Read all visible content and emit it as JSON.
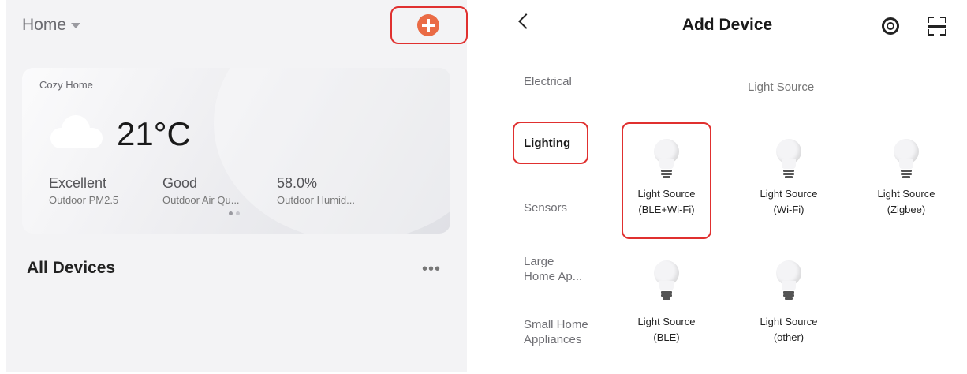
{
  "left": {
    "home_title": "Home",
    "card": {
      "label": "Cozy Home",
      "temperature": "21°C",
      "metrics": [
        {
          "value": "Excellent",
          "label": "Outdoor PM2.5"
        },
        {
          "value": "Good",
          "label": "Outdoor Air Qu..."
        },
        {
          "value": "58.0%",
          "label": "Outdoor Humid..."
        }
      ],
      "pager": {
        "total": 2,
        "active": 1
      }
    },
    "all_devices": "All Devices",
    "more": "•••",
    "accent_color": "#ea6b45",
    "highlight_color": "#e0302f"
  },
  "right": {
    "title": "Add Device",
    "categories": [
      {
        "line1": "Electrical",
        "line2": ""
      },
      {
        "line1": "Lighting",
        "line2": ""
      },
      {
        "line1": "Sensors",
        "line2": ""
      },
      {
        "line1": "Large",
        "line2": "Home Ap..."
      },
      {
        "line1": "Small Home",
        "line2": "Appliances"
      }
    ],
    "selected_category": "Lighting",
    "section_title": "Light Source",
    "devices": [
      {
        "line1": "Light Source",
        "line2": "(BLE+Wi-Fi)"
      },
      {
        "line1": "Light Source",
        "line2": "(Wi-Fi)"
      },
      {
        "line1": "Light Source",
        "line2": "(Zigbee)"
      },
      {
        "line1": "",
        "line2": ""
      },
      {
        "line1": "Light Source",
        "line2": "(BLE)"
      },
      {
        "line1": "Light Source",
        "line2": "(other)"
      }
    ]
  }
}
